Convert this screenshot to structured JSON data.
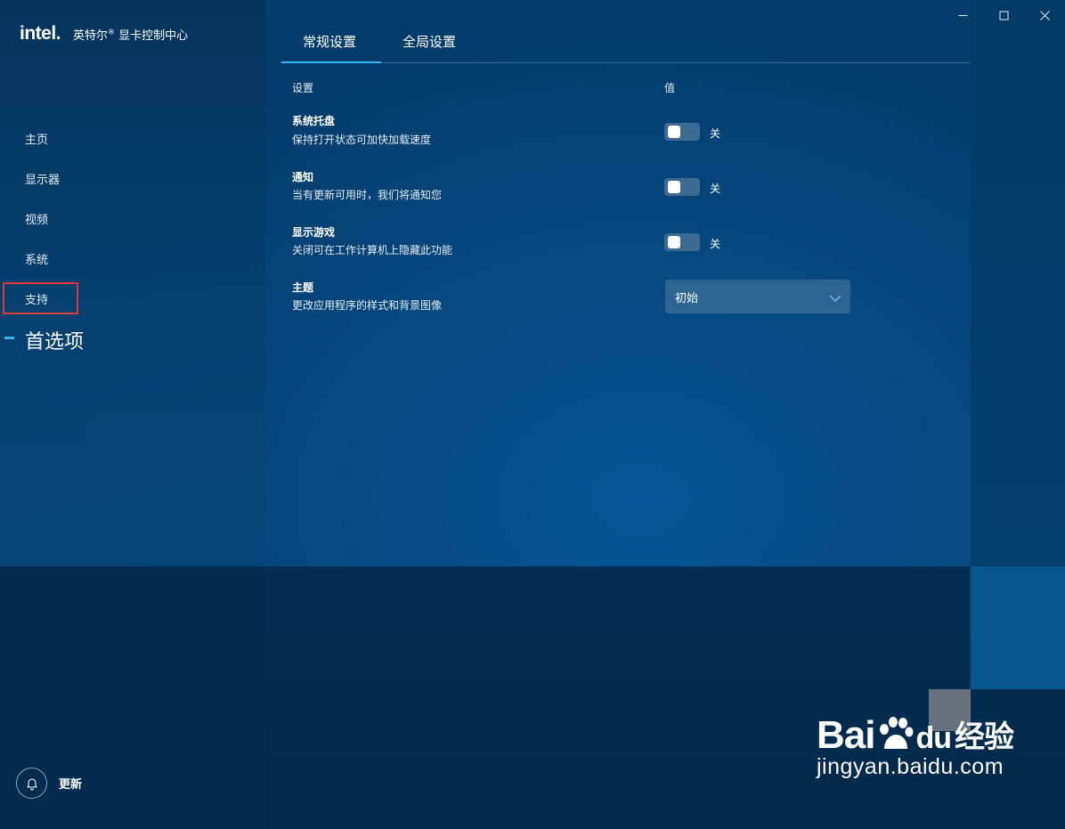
{
  "window": {
    "minimize_icon": "minimize-icon",
    "maximize_icon": "maximize-icon",
    "close_icon": "close-icon"
  },
  "app": {
    "logo": "intel.",
    "title": "英特尔",
    "title_mark": "®",
    "title_suffix": " 显卡控制中心"
  },
  "sidebar": {
    "items": [
      {
        "label": "主页"
      },
      {
        "label": "显示器"
      },
      {
        "label": "视频"
      },
      {
        "label": "系统"
      },
      {
        "label": "支持"
      }
    ],
    "active_label": "首选项",
    "update_label": "更新",
    "update_icon": "bell-icon"
  },
  "tabs": [
    {
      "label": "常规设置",
      "active": true
    },
    {
      "label": "全局设置",
      "active": false
    }
  ],
  "table": {
    "col_setting": "设置",
    "col_value": "值"
  },
  "settings": [
    {
      "title": "系统托盘",
      "desc": "保持打开状态可加快加载速度",
      "state": "关"
    },
    {
      "title": "通知",
      "desc": "当有更新可用时，我们将通知您",
      "state": "关"
    },
    {
      "title": "显示游戏",
      "desc": "关闭可在工作计算机上隐藏此功能",
      "state": "关"
    },
    {
      "title": "主题",
      "desc": "更改应用程序的样式和背景图像",
      "value": "初始"
    }
  ],
  "watermark": {
    "brand_left": "Bai",
    "brand_mid": "du",
    "brand_right": "经验",
    "url": "jingyan.baidu.com"
  },
  "colors": {
    "accent": "#31b6f2",
    "highlight_box": "#e0373b",
    "toggle_off": "#3b6b93"
  }
}
